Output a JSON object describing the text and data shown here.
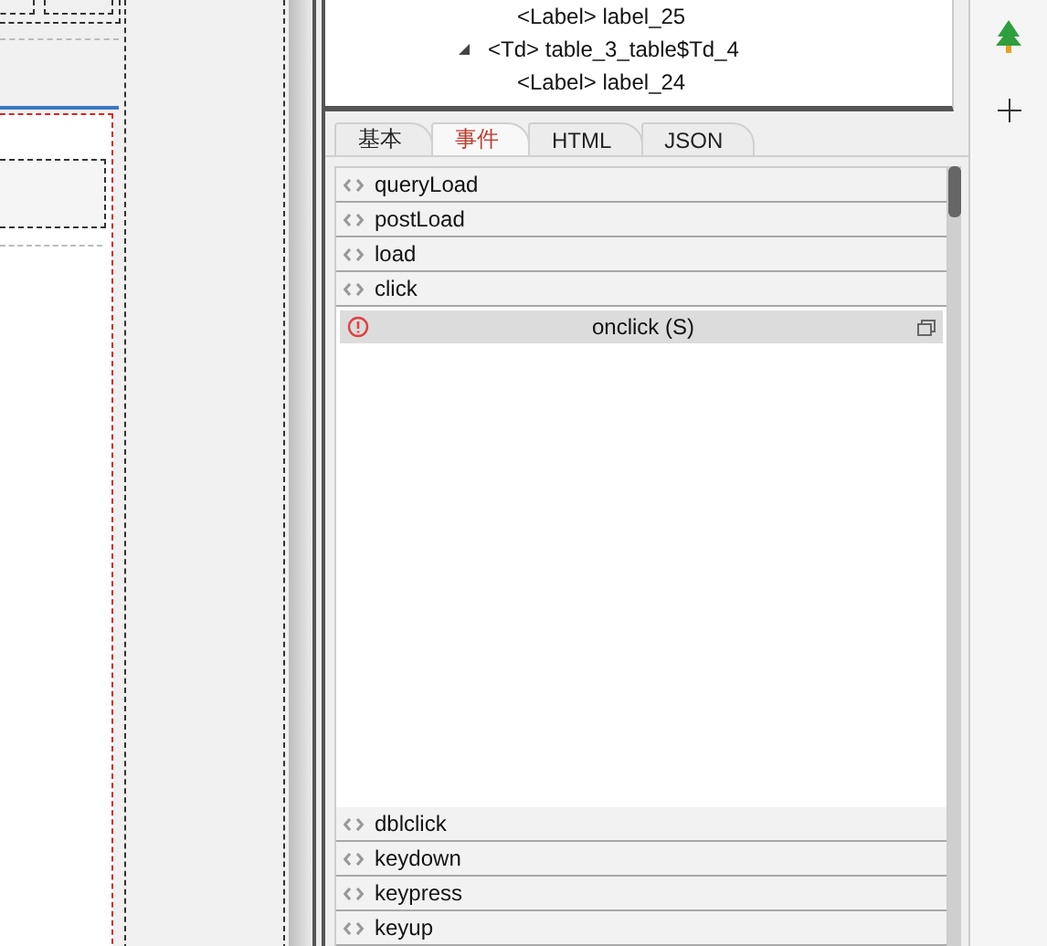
{
  "tree": {
    "items": [
      {
        "children": [
          {
            "label": "<Label> label_25"
          }
        ]
      },
      {
        "label": "<Td> table_3_table$Td_4",
        "expanded": true,
        "children": [
          {
            "label": "<Label> label_24"
          }
        ]
      }
    ]
  },
  "tabs": [
    {
      "label": "基本",
      "selected": false
    },
    {
      "label": "事件",
      "selected": true
    },
    {
      "label": "HTML",
      "selected": false
    },
    {
      "label": "JSON",
      "selected": false
    }
  ],
  "events": [
    {
      "name": "queryLoad",
      "expanded": false
    },
    {
      "name": "postLoad",
      "expanded": false
    },
    {
      "name": "load",
      "expanded": false
    },
    {
      "name": "click",
      "expanded": true,
      "editor": {
        "title": "onclick (S)"
      }
    },
    {
      "name": "dblclick",
      "expanded": false
    },
    {
      "name": "keydown",
      "expanded": false
    },
    {
      "name": "keypress",
      "expanded": false
    },
    {
      "name": "keyup",
      "expanded": false
    }
  ]
}
